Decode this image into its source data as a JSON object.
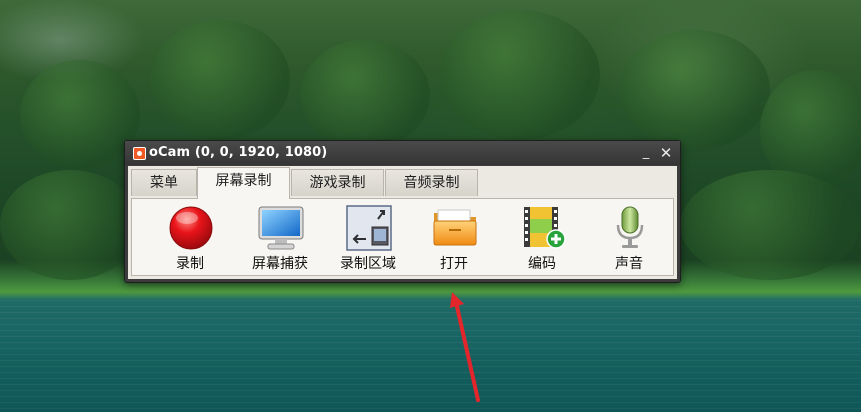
{
  "window": {
    "title": "oCam (0, 0, 1920, 1080)",
    "minimize_symbol": "_",
    "close_symbol": "✕"
  },
  "tabs": [
    {
      "label": "菜单",
      "active": false
    },
    {
      "label": "屏幕录制",
      "active": true
    },
    {
      "label": "游戏录制",
      "active": false
    },
    {
      "label": "音频录制",
      "active": false
    }
  ],
  "toolbar": [
    {
      "label": "录制",
      "icon": "record-icon"
    },
    {
      "label": "屏幕捕获",
      "icon": "monitor-icon"
    },
    {
      "label": "录制区域",
      "icon": "resize-area-icon"
    },
    {
      "label": "打开",
      "icon": "folder-icon"
    },
    {
      "label": "编码",
      "icon": "film-add-icon"
    },
    {
      "label": "声音",
      "icon": "microphone-icon"
    }
  ],
  "colors": {
    "titlebar": "#3c3c3c",
    "annotation_arrow": "#e3262b"
  }
}
